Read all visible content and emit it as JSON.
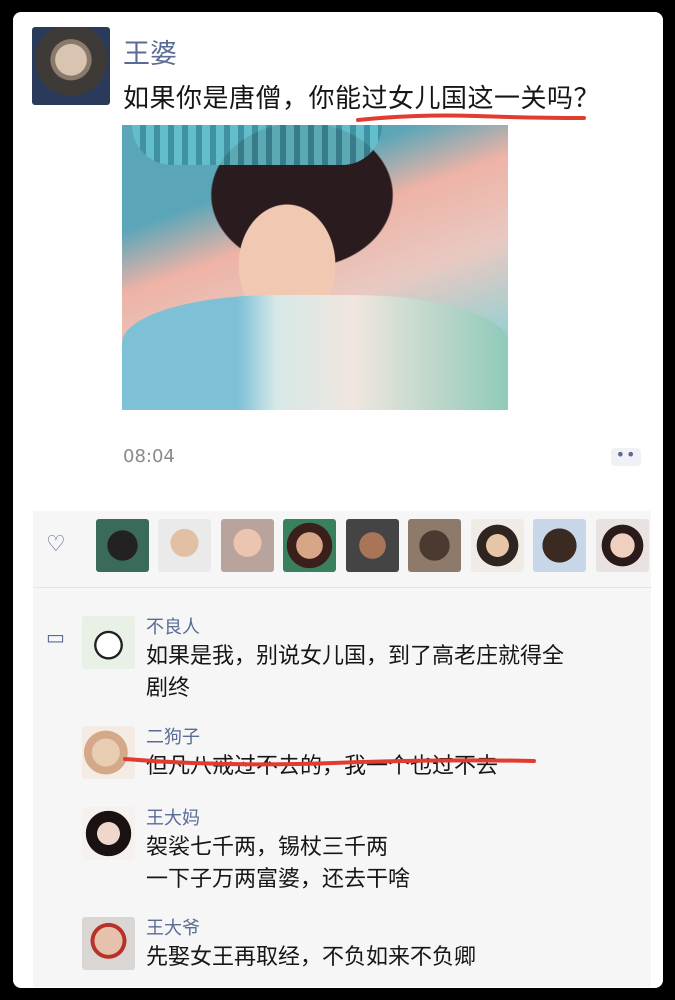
{
  "post": {
    "author": "王婆",
    "text": "如果你是唐僧，你能过女儿国这一关吗？",
    "time": "08:04",
    "more_icon": "ellipsis-icon",
    "highlight_color": "#e23b30"
  },
  "likes": {
    "icon": "heart-icon",
    "count_visible": 9
  },
  "comments": [
    {
      "name": "不良人",
      "text": "如果是我，别说女儿国，到了高老庄就得全剧终"
    },
    {
      "name": "二狗子",
      "text": "但凡八戒过不去的，我一个也过不去"
    },
    {
      "name": "王大妈",
      "text": "袈裟七千两，锡杖三千两\n一下子万两富婆，还去干啥"
    },
    {
      "name": "王大爷",
      "text": "先娶女王再取经，不负如来不负卿"
    }
  ],
  "colors": {
    "name": "#5a6b94",
    "text": "#161616",
    "meta": "#8a8a8a",
    "panel": "#f6f6f6"
  }
}
